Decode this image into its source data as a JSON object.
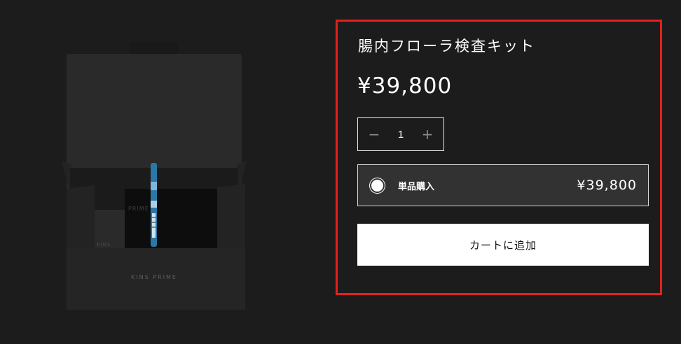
{
  "product": {
    "title": "腸内フローラ検査キット",
    "price": "¥39,800",
    "image_brand_text": "KINS PRIME",
    "image_small_text": "KINS",
    "image_card_text": "PRIME"
  },
  "quantity": {
    "minus": "−",
    "value": "1",
    "plus": "+"
  },
  "purchase_option": {
    "label": "単品購入",
    "price": "¥39,800",
    "selected": true
  },
  "cart": {
    "add_label": "カートに追加"
  },
  "colors": {
    "background": "#1c1c1d",
    "highlight_border": "#e3211c",
    "option_background": "#333233",
    "button_background": "#ffffff"
  }
}
